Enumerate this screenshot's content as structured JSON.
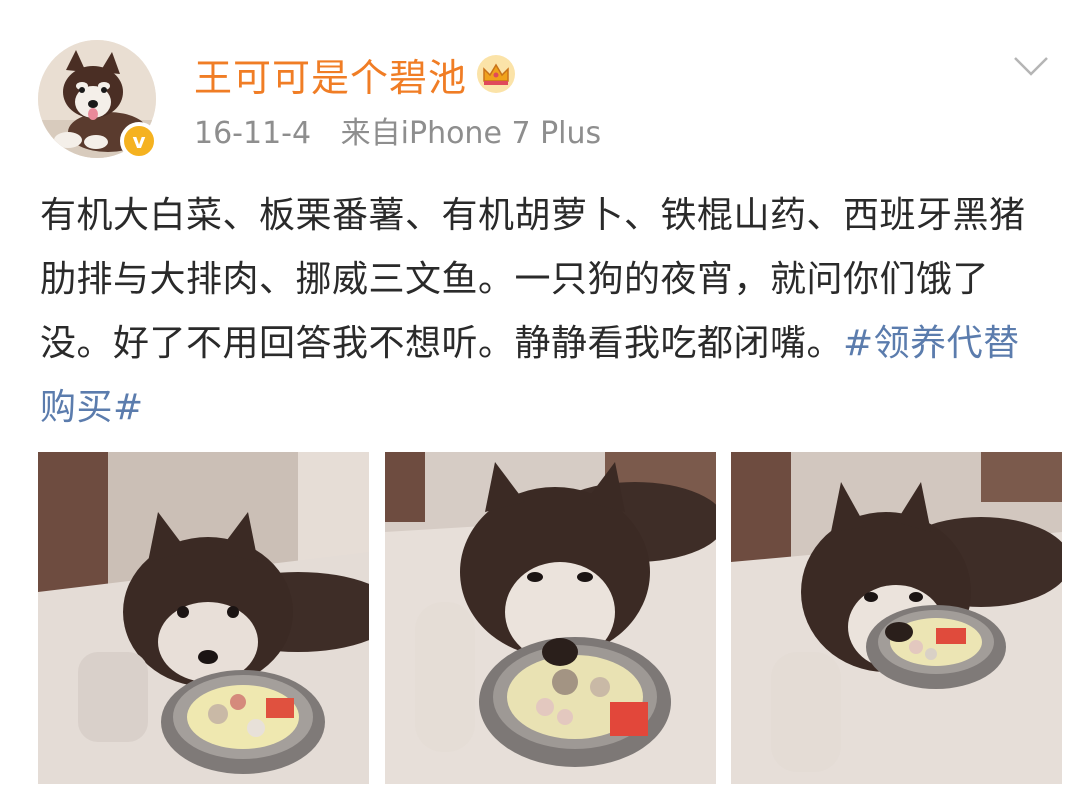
{
  "user": {
    "name": "王可可是个碧池",
    "verified_mark": "v",
    "avatar_icon": "husky-puppy-avatar",
    "badge_icon": "crown-icon"
  },
  "meta": {
    "date": "16-11-4",
    "source": "来自iPhone 7 Plus"
  },
  "post": {
    "text": "有机大白菜、板栗番薯、有机胡萝卜、铁棍山药、西班牙黑猪肋排与大排肉、挪威三文鱼。一只狗的夜宵，就问你们饿了没。好了不用回答我不想听。静静看我吃都闭嘴。",
    "hashtag": "#领养代替购买#"
  },
  "photos": [
    {
      "icon": "husky-eating-photo-1"
    },
    {
      "icon": "husky-eating-photo-2"
    },
    {
      "icon": "husky-eating-photo-3"
    }
  ],
  "colors": {
    "username": "#f07d25",
    "meta": "#8e8e8e",
    "text": "#2a2a2a",
    "hashtag": "#5b7cad",
    "verified": "#f5b220"
  }
}
